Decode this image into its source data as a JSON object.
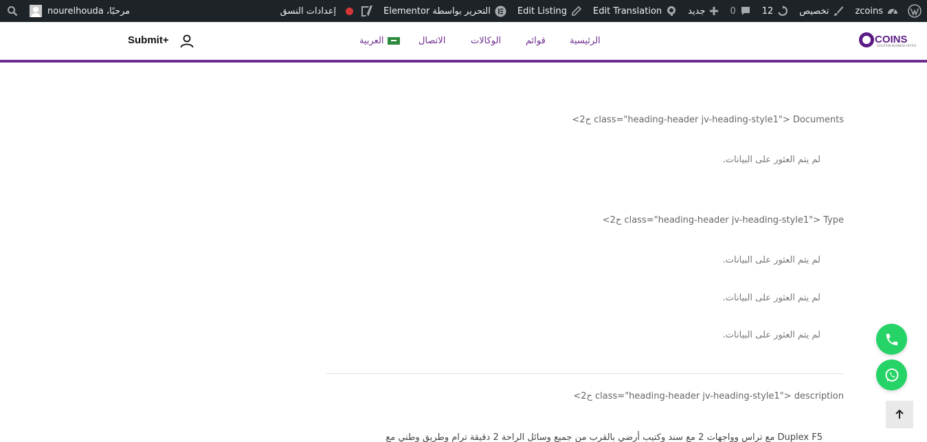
{
  "admin_bar": {
    "site_name": "zcoins",
    "customize": "تخصيص",
    "updates_count": "12",
    "comments_count": "0",
    "new_label": "جديد",
    "edit_translation": "Edit Translation",
    "edit_listing": "Edit Listing",
    "elementor_label": "التحرير بواسطة Elementor",
    "theme_settings": "إعدادات النسق",
    "greeting": "مرحبًا، nourelhouda"
  },
  "header": {
    "logo_text": "COINS",
    "logo_subtitle": "SOLUTION BUSINESS OFFICE",
    "nav": {
      "home": "الرئيسية",
      "listings": "قوائم",
      "agencies": "الوكالات",
      "contact": "الاتصال",
      "language": "العربية"
    },
    "submit_label": "Submit+"
  },
  "content": {
    "documents_heading": "<ح2 class=\"heading-header jv-heading-style1\"> Documents",
    "no_data_1": "لم يتم العثور على البيانات.",
    "type_heading": "<ح2 class=\"heading-header jv-heading-style1\"> Type",
    "type_rows": [
      "لم يتم العثور على البيانات.",
      "لم يتم العثور على البيانات.",
      "لم يتم العثور على البيانات."
    ],
    "description_heading": "<ح2 class=\"heading-header jv-heading-style1\"> description",
    "description_line1": "Duplex F5 مع تراس وواجهات 2 مع سند وكتيب أرضي بالقرب من جميع وسائل الراحة 2 دقيقة ترام وطريق وطني مع"
  },
  "colors": {
    "adminbar_bg": "#1d2327",
    "brand_purple": "#6d2c8e",
    "whatsapp_green": "#25d366"
  },
  "icons": [
    "wordpress-icon",
    "dashboard-icon",
    "brush-icon",
    "updates-icon",
    "comment-icon",
    "plus-icon",
    "translate-icon",
    "pencil-icon",
    "elementor-icon",
    "yoast-icon",
    "status-dot-icon",
    "avatar-icon",
    "search-icon",
    "user-icon",
    "phone-icon",
    "whatsapp-icon",
    "arrow-up-icon"
  ]
}
